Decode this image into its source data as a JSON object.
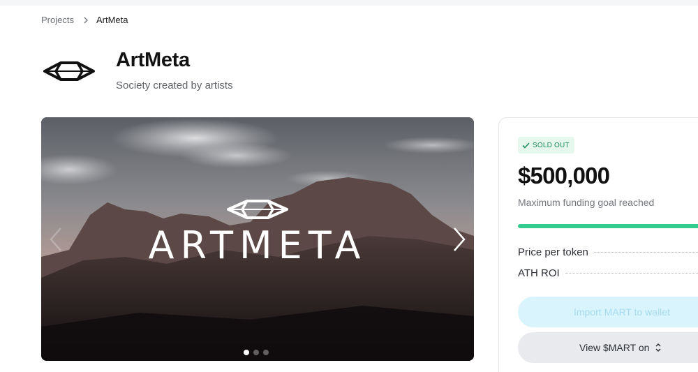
{
  "breadcrumb": {
    "parent": "Projects",
    "current": "ArtMeta"
  },
  "project": {
    "name": "ArtMeta",
    "tagline": "Society created by artists",
    "logo_icon": "artmeta-diamond-logo-icon"
  },
  "carousel": {
    "wordmark": "ARTMETA",
    "slide_count": 3,
    "active_slide": 1,
    "prev_icon": "chevron-left-icon",
    "next_icon": "chevron-right-icon"
  },
  "funding": {
    "status_badge": "SOLD OUT",
    "status_icon": "check-icon",
    "amount": "$500,000",
    "goal_text": "Maximum funding goal reached",
    "progress_fraction": 1.0,
    "price_label": "Price per token",
    "roi_label": "ATH ROI",
    "import_button": "Import MART to wallet",
    "view_button": "View $MART on",
    "view_button_icon": "chevron-up-down-icon"
  },
  "colors": {
    "accent_green": "#33cc8e",
    "badge_bg": "#e6f7ee",
    "badge_text": "#1f8a5a",
    "import_bg": "#d9f4fd",
    "view_bg": "#e8eaed"
  }
}
